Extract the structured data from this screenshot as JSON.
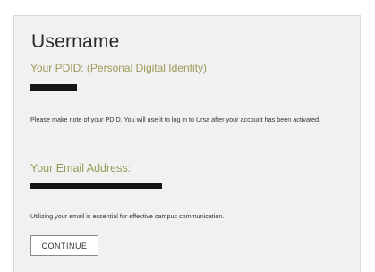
{
  "form": {
    "title": "Username",
    "pdid_label": "Your PDID: (Personal Digital Identity)",
    "pdid_value_redacted": true,
    "pdid_note": "Please make note of your PDID. You will use it to log in to Ursa after your account has been activated.",
    "email_label": "Your Email Address:",
    "email_value_redacted": true,
    "email_note": "Utilizing your email is essential for effective campus communication.",
    "continue_label": "CONTINUE"
  }
}
